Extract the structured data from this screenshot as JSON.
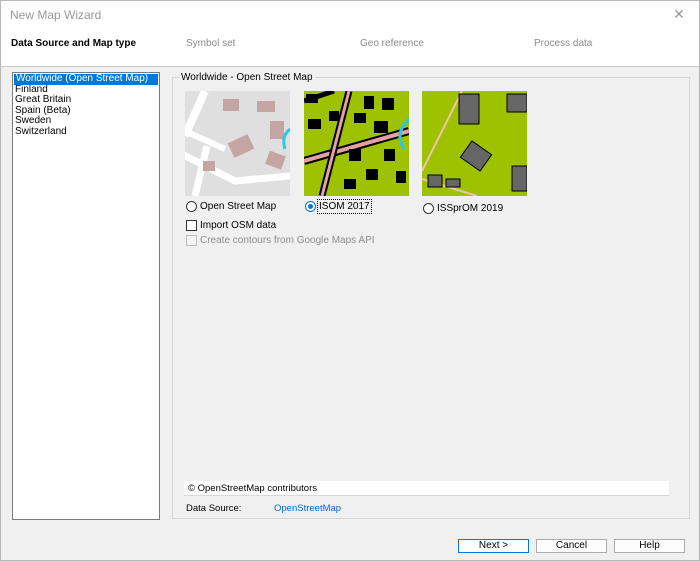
{
  "window": {
    "title": "New Map Wizard",
    "close_glyph": "✕"
  },
  "steps": [
    {
      "label": "Data Source and Map type",
      "active": true
    },
    {
      "label": "Symbol set",
      "active": false
    },
    {
      "label": "Geo reference",
      "active": false
    },
    {
      "label": "Process data",
      "active": false
    }
  ],
  "regions": [
    "Worldwide (Open Street Map)",
    "Finland",
    "Great Britain",
    "Spain (Beta)",
    "Sweden",
    "Switzerland"
  ],
  "selected_region": "Worldwide (Open Street Map)",
  "group": {
    "title": "Worldwide - Open Street Map"
  },
  "map_types": [
    {
      "label": "Open Street Map",
      "checked": false
    },
    {
      "label": "ISOM 2017",
      "checked": true
    },
    {
      "label": "ISSprOM 2019",
      "checked": false
    }
  ],
  "options": {
    "import_osm": {
      "label": "Import OSM data",
      "checked": false
    },
    "contours": {
      "label": "Create contours from Google Maps API",
      "checked": false,
      "disabled": true
    }
  },
  "attribution": "© OpenStreetMap contributors",
  "data_source": {
    "label": "Data Source:",
    "value": "OpenStreetMap"
  },
  "buttons": {
    "next": "Next  >",
    "cancel": "Cancel",
    "help": "Help"
  },
  "colors": {
    "accent": "#0078d7",
    "isom_green": "#9ec100",
    "osm_bg": "#e0dfdf",
    "building_osm": "#c5a5a4",
    "road_pink": "#e6a0a0",
    "water": "#27c8e8"
  }
}
